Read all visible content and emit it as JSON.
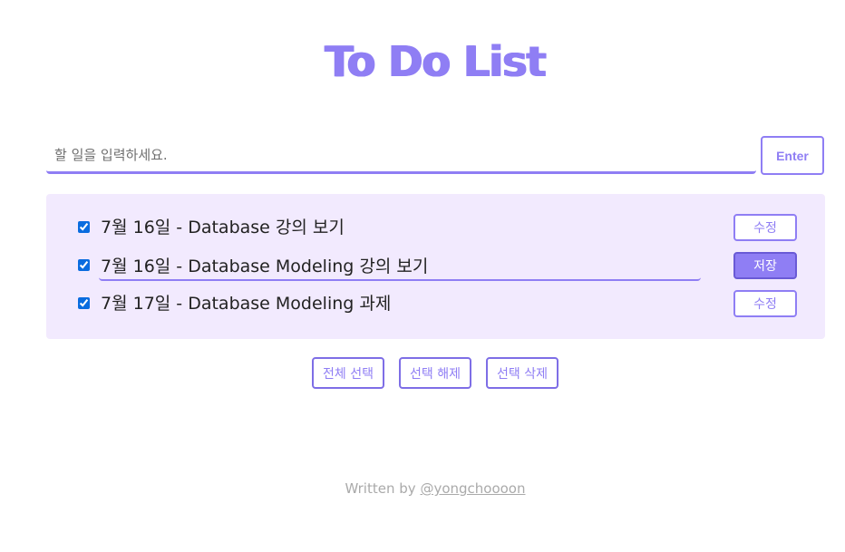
{
  "header": {
    "title": "To Do List"
  },
  "input": {
    "placeholder": "할 일을 입력하세요.",
    "value": "",
    "enter_label": "Enter"
  },
  "todos": [
    {
      "text": "7월 16일 - Database 강의 보기",
      "checked": true,
      "editing": false,
      "button_label": "수정"
    },
    {
      "text": "7월 16일 - Database Modeling 강의 보기",
      "checked": true,
      "editing": true,
      "button_label": "저장"
    },
    {
      "text": "7월 17일 - Database Modeling 과제",
      "checked": true,
      "editing": false,
      "button_label": "수정"
    }
  ],
  "actions": {
    "select_all": "전체 선택",
    "deselect": "선택 해제",
    "delete_selected": "선택 삭제"
  },
  "footer": {
    "prefix": "Written by",
    "author": "@yongchoooon"
  },
  "colors": {
    "accent": "#8f7ef4",
    "list_bg": "#f2eafe"
  }
}
